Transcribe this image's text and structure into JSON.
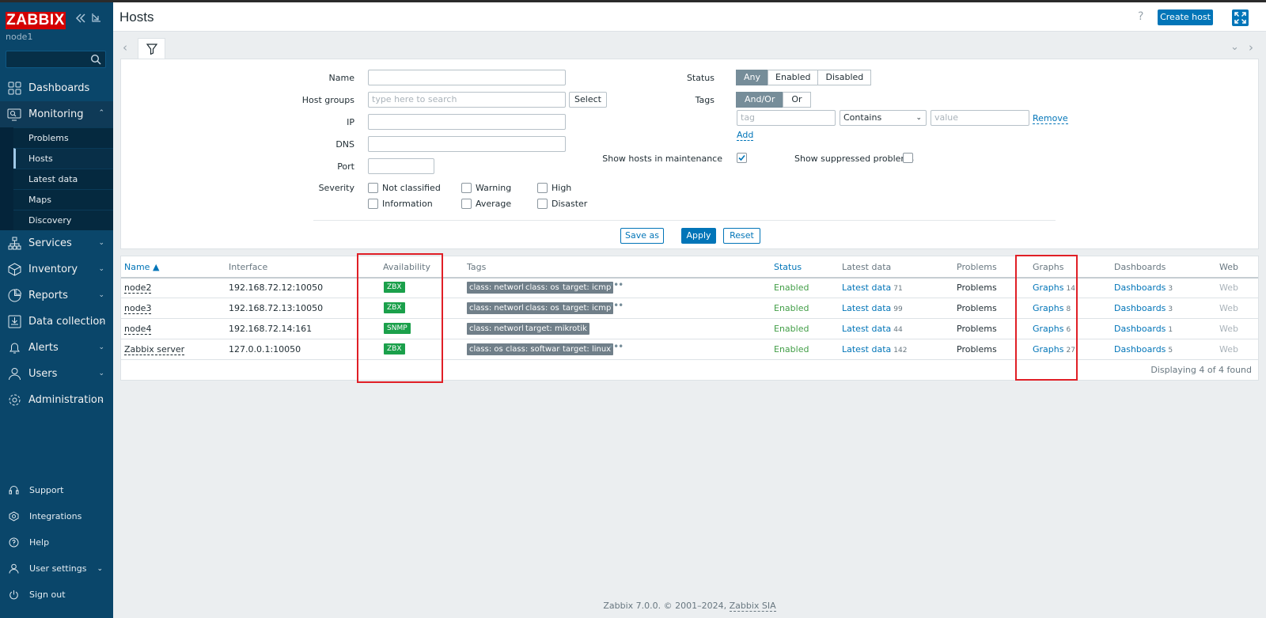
{
  "app": {
    "logo": "ZABBIX",
    "node": "node1"
  },
  "sidebar": {
    "menu": [
      {
        "label": "Dashboards"
      },
      {
        "label": "Monitoring"
      },
      {
        "label": "Services"
      },
      {
        "label": "Inventory"
      },
      {
        "label": "Reports"
      },
      {
        "label": "Data collection"
      },
      {
        "label": "Alerts"
      },
      {
        "label": "Users"
      },
      {
        "label": "Administration"
      }
    ],
    "monitoring_sub": [
      "Problems",
      "Hosts",
      "Latest data",
      "Maps",
      "Discovery"
    ],
    "bottom": [
      "Support",
      "Integrations",
      "Help",
      "User settings",
      "Sign out"
    ]
  },
  "header": {
    "title": "Hosts",
    "help": "?",
    "create_host": "Create host"
  },
  "filter": {
    "labels": {
      "name": "Name",
      "host_groups": "Host groups",
      "ip": "IP",
      "dns": "DNS",
      "port": "Port",
      "severity": "Severity",
      "status": "Status",
      "tags": "Tags"
    },
    "host_groups_placeholder": "type here to search",
    "select_btn": "Select",
    "severity": [
      "Not classified",
      "Warning",
      "High",
      "Information",
      "Average",
      "Disaster"
    ],
    "status_options": [
      "Any",
      "Enabled",
      "Disabled"
    ],
    "tags_options": [
      "And/Or",
      "Or"
    ],
    "tag_placeholder": "tag",
    "tag_operator": "Contains",
    "value_placeholder": "value",
    "remove": "Remove",
    "add": "Add",
    "show_maintenance": "Show hosts in maintenance",
    "show_suppressed": "Show suppressed problems",
    "save_as": "Save as",
    "apply": "Apply",
    "reset": "Reset"
  },
  "table": {
    "columns": [
      "Name ▲",
      "Interface",
      "Availability",
      "Tags",
      "Status",
      "Latest data",
      "Problems",
      "Graphs",
      "Dashboards",
      "Web"
    ],
    "rows": [
      {
        "name": "node2",
        "interface": "192.168.72.12:10050",
        "availability": "ZBX",
        "tags": [
          "class: network",
          "class: os",
          "target: icmp"
        ],
        "status": "Enabled",
        "latest": "Latest data",
        "latest_count": "71",
        "problems": "Problems",
        "graphs": "Graphs",
        "graphs_count": "14",
        "dashboards": "Dashboards",
        "dashboards_count": "3",
        "web": "Web"
      },
      {
        "name": "node3",
        "interface": "192.168.72.13:10050",
        "availability": "ZBX",
        "tags": [
          "class: network",
          "class: os",
          "target: icmp"
        ],
        "status": "Enabled",
        "latest": "Latest data",
        "latest_count": "99",
        "problems": "Problems",
        "graphs": "Graphs",
        "graphs_count": "8",
        "dashboards": "Dashboards",
        "dashboards_count": "3",
        "web": "Web"
      },
      {
        "name": "node4",
        "interface": "192.168.72.14:161",
        "availability": "SNMP",
        "tags": [
          "class: network",
          "target: mikrotik"
        ],
        "status": "Enabled",
        "latest": "Latest data",
        "latest_count": "44",
        "problems": "Problems",
        "graphs": "Graphs",
        "graphs_count": "6",
        "dashboards": "Dashboards",
        "dashboards_count": "1",
        "web": "Web"
      },
      {
        "name": "Zabbix server",
        "interface": "127.0.0.1:10050",
        "availability": "ZBX",
        "tags": [
          "class: os",
          "class: software",
          "target: linux"
        ],
        "status": "Enabled",
        "latest": "Latest data",
        "latest_count": "142",
        "problems": "Problems",
        "graphs": "Graphs",
        "graphs_count": "27",
        "dashboards": "Dashboards",
        "dashboards_count": "5",
        "web": "Web"
      }
    ],
    "displaying": "Displaying 4 of 4 found"
  },
  "footer": {
    "text": "Zabbix 7.0.0. © 2001–2024, ",
    "link": "Zabbix SIA"
  },
  "colors": {
    "sidebar": "#0a466a",
    "accent": "#0275b8",
    "available": "#1ba04b",
    "enabled": "#429e47",
    "highlight_box": "#e01f26"
  }
}
